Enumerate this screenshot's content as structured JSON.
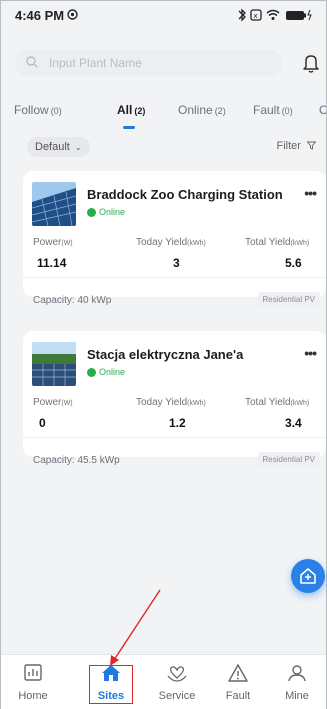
{
  "status_bar": {
    "time": "4:46 PM",
    "icons": [
      "bluetooth-icon",
      "sim-icon",
      "wifi-icon",
      "battery-icon"
    ]
  },
  "search": {
    "placeholder": "Input Plant Name"
  },
  "tabs": [
    {
      "label": "Follow",
      "count": "(0)"
    },
    {
      "label": "All",
      "count": "(2)",
      "active": true
    },
    {
      "label": "Online",
      "count": "(2)"
    },
    {
      "label": "Fault",
      "count": "(0)"
    },
    {
      "label": "O",
      "count": ""
    }
  ],
  "sort": {
    "label": "Default"
  },
  "filter": {
    "label": "Filter"
  },
  "plants": [
    {
      "name": "Braddock Zoo Charging Station",
      "status": "Online",
      "power_label": "Power",
      "power_unit": "(W)",
      "power": "11.14",
      "today_label": "Today Yield",
      "today_unit": "(kWh)",
      "today": "3",
      "total_label": "Total Yield",
      "total_unit": "(kWh)",
      "total": "5.6",
      "capacity": "Capacity: 40 kWp",
      "type": "Residential PV"
    },
    {
      "name": "Stacja elektryczna Jane'a",
      "status": "Online",
      "power_label": "Power",
      "power_unit": "(W)",
      "power": "0",
      "today_label": "Today Yield",
      "today_unit": "(kWh)",
      "today": "1.2",
      "total_label": "Total Yield",
      "total_unit": "(kWh)",
      "total": "3.4",
      "capacity": "Capacity: 45.5 kWp",
      "type": "Residential PV"
    }
  ],
  "bottom_nav": [
    {
      "label": "Home",
      "icon": "chart-icon"
    },
    {
      "label": "Sites",
      "icon": "house-icon",
      "active": true
    },
    {
      "label": "Service",
      "icon": "heart-hands-icon"
    },
    {
      "label": "Fault",
      "icon": "warning-icon"
    },
    {
      "label": "Mine",
      "icon": "person-icon"
    }
  ],
  "colors": {
    "accent": "#1f7ae0",
    "online": "#23b14d",
    "annotation": "#e02828"
  }
}
